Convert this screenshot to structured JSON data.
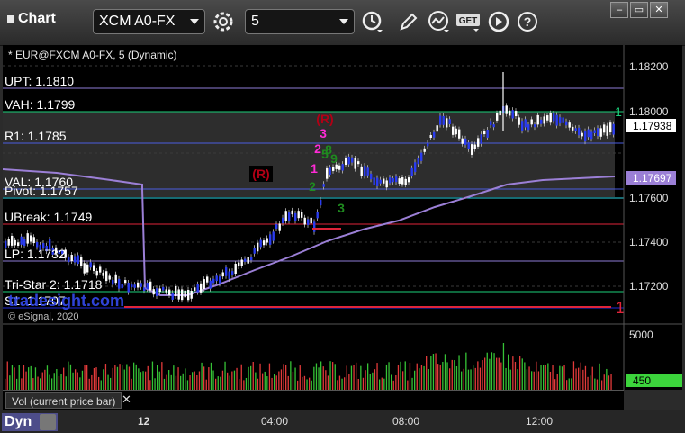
{
  "window": {
    "title": "Chart",
    "symbol": "XCM A0-FX",
    "interval": "5",
    "get_label": "GET",
    "minimize": "–",
    "restore": "▭",
    "close": "✕",
    "help": "?"
  },
  "chart": {
    "header": "* EUR@FXCM A0-FX, 5 (Dynamic)",
    "watermark": "tradesight.com",
    "copyright": "© eSignal, 2020",
    "price_labels": [
      "1.18200",
      "1.18000",
      "1.17600",
      "1.17400",
      "1.17200"
    ],
    "last_price": "1.17938",
    "ma_price": "1.17697",
    "levels": [
      {
        "text": "UPT: 1.1810",
        "color": "#8e7bd6"
      },
      {
        "text": "VAH: 1.1799",
        "color": "#1bd07a"
      },
      {
        "text": "R1: 1.1785",
        "color": "#4a5de0"
      },
      {
        "text": "VAL: 1.1760",
        "color": "#4a5de0"
      },
      {
        "text": "Pivot: 1.1757",
        "color": "#2bd6e6"
      },
      {
        "text": "UBreak: 1.1749",
        "color": "#e0243a"
      },
      {
        "text": "LP: 1.1732",
        "color": "#8e7bd6"
      },
      {
        "text": "Tri-Star 2: 1.1718",
        "color": "#1bd07a"
      },
      {
        "text": "S1: 1.1707",
        "color": "#1f2ad6"
      }
    ],
    "markers": {
      "r1": "(R)",
      "r2": "(R)",
      "n1": "1",
      "n2": "2",
      "n3": "3",
      "g9": "9",
      "g8": "8",
      "g5": "5",
      "g3": "3",
      "g2": "2",
      "flag1": "1",
      "flag_green": "1"
    },
    "colors": {
      "up": "#ffffff",
      "down": "#2a3cf0",
      "ma": "#9b7fd6",
      "last_price_bg": "#ffffff",
      "ma_bg": "#9b7fd6"
    }
  },
  "volume": {
    "scale_top": "5000",
    "current": "450",
    "label": "Vol (current price bar)",
    "close": "✕"
  },
  "time_axis": {
    "labels": [
      "12",
      "04:00",
      "08:00",
      "12:00"
    ]
  },
  "footer": {
    "dyn": "Dyn"
  }
}
